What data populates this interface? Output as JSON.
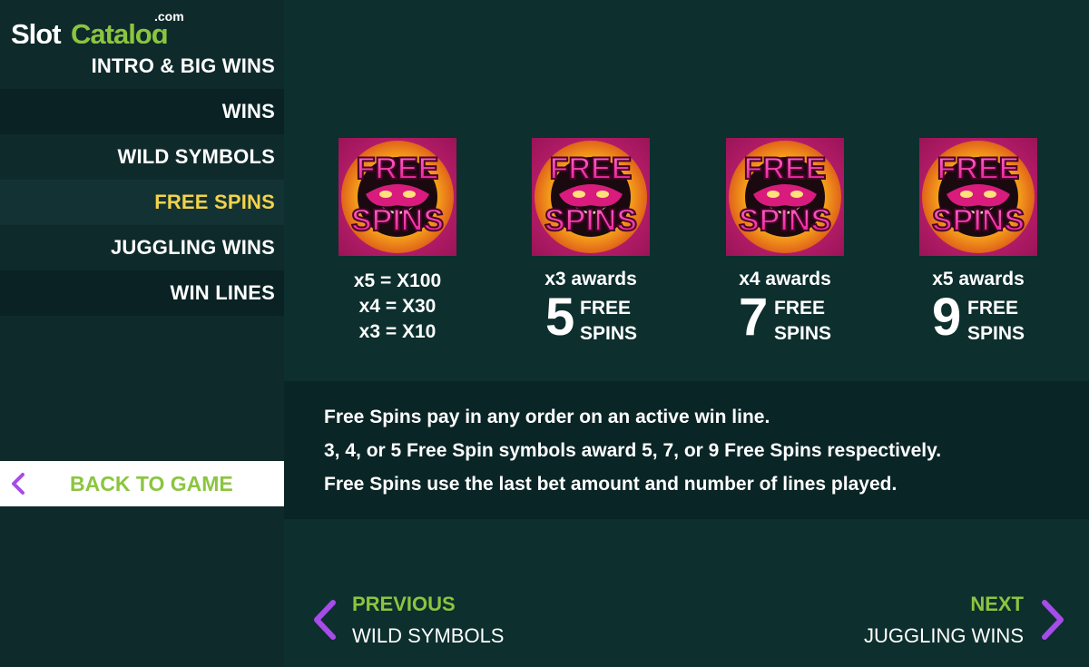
{
  "logo": {
    "slot": "Slot",
    "catalog": "Catalog",
    "com": ".com"
  },
  "nav": {
    "items": [
      {
        "label": "INTRO & BIG WINS"
      },
      {
        "label": "WINS"
      },
      {
        "label": "WILD SYMBOLS"
      },
      {
        "label": "FREE SPINS"
      },
      {
        "label": "JUGGLING WINS"
      },
      {
        "label": "WIN LINES"
      }
    ],
    "active_index": 3
  },
  "back": {
    "label": "BACK TO GAME"
  },
  "symbol": {
    "line1": "FREE",
    "line2": "SPINS"
  },
  "paytable": {
    "x5": "x5 = X100",
    "x4": "x4 = X30",
    "x3": "x3 = X10"
  },
  "awards": [
    {
      "label": "x3 awards",
      "number": "5",
      "line1": "FREE",
      "line2": "SPINS"
    },
    {
      "label": "x4 awards",
      "number": "7",
      "line1": "FREE",
      "line2": "SPINS"
    },
    {
      "label": "x5 awards",
      "number": "9",
      "line1": "FREE",
      "line2": "SPINS"
    }
  ],
  "description": [
    "Free Spins pay in any order on an active win line.",
    "3, 4, or 5 Free Spin symbols award 5, 7, or 9 Free Spins respectively.",
    "Free Spins use the last bet amount and number of lines played."
  ],
  "pager": {
    "previous_label": "PREVIOUS",
    "previous_target": "WILD SYMBOLS",
    "next_label": "NEXT",
    "next_target": "JUGGLING WINS"
  },
  "colors": {
    "accent_green": "#8bc53f",
    "active_yellow": "#f2d34a",
    "chevron_purple": "#a64ce8",
    "background": "#0d2d2e"
  }
}
